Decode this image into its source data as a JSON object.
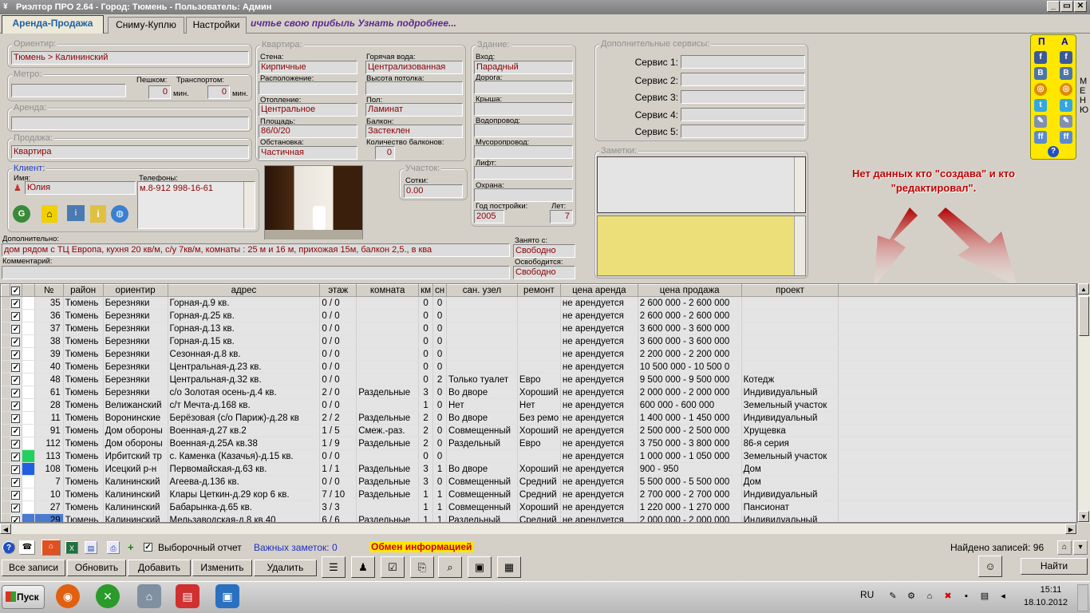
{
  "window": {
    "title": "Риэлтор ПРО 2.64 - Город: Тюмень - Пользователь: Админ",
    "minimize": "_",
    "restore": "▭",
    "close": "✕"
  },
  "tabs": [
    {
      "label": "Аренда-Продажа"
    },
    {
      "label": "Сниму-Куплю"
    },
    {
      "label": "Настройки"
    }
  ],
  "ticker": "ичтье свою прибыль Узнать подробнее...",
  "orientir": {
    "title": "Ориентир:",
    "value": "Тюмень > Калининский"
  },
  "metro": {
    "title": "Метро:",
    "walk_label": "Пешком:",
    "walk_value": "0",
    "transport_label": "Транспортом:",
    "transport_value": "0",
    "unit": "мин."
  },
  "arenda": {
    "title": "Аренда:",
    "value": ""
  },
  "prodazha": {
    "title": "Продажа:",
    "value": "Квартира"
  },
  "client": {
    "title": "Клиент:",
    "name_label": "Имя:",
    "name_value": "Юлия",
    "phones_label": "Телефоны:",
    "phones_value": "м.8-912 998-16-61"
  },
  "apartment": {
    "title": "Квартира:",
    "walls_label": "Стена:",
    "walls_value": "Кирпичные",
    "hotwater_label": "Горячая вода:",
    "hotwater_value": "Централизованная",
    "location_label": "Расположение:",
    "location_value": "",
    "ceiling_label": "Высота потолка:",
    "ceiling_value": "",
    "heating_label": "Отопление:",
    "heating_value": "Центральное",
    "floor_label": "Пол:",
    "floor_value": "Ламинат",
    "area_label": "Площадь:",
    "area_value": "86/0/20",
    "balcony_label": "Балкон:",
    "balcony_value": "Застеклен",
    "furniture_label": "Обстановка:",
    "furniture_value": "Частичная",
    "balcony_count_label": "Количество балконов:",
    "balcony_count_value": "0"
  },
  "plot": {
    "title": "Участок:",
    "sotki_label": "Сотки:",
    "sotki_value": "0.00"
  },
  "building": {
    "title": "Здание:",
    "entrance_label": "Вход:",
    "entrance_value": "Парадный",
    "road_label": "Дорога:",
    "road_value": "",
    "roof_label": "Крыша:",
    "roof_value": "",
    "water_label": "Водопровод:",
    "water_value": "",
    "trash_label": "Мусоропровод:",
    "trash_value": "",
    "lift_label": "Лифт:",
    "lift_value": "",
    "security_label": "Охрана:",
    "security_value": "",
    "year_label": "Год постройки:",
    "year_value": "2005",
    "age_label": "Лет:",
    "age_value": "7"
  },
  "services": {
    "title": "Дополнительные сервисы:",
    "items": [
      {
        "label": "Сервис 1:"
      },
      {
        "label": "Сервис 2:"
      },
      {
        "label": "Сервис 3:"
      },
      {
        "label": "Сервис 4:"
      },
      {
        "label": "Сервис 5:"
      }
    ]
  },
  "notes": {
    "title": "Заметки:"
  },
  "social": {
    "col1": "П",
    "col2": "А",
    "help": "?"
  },
  "menu_vertical": "МЕНЮ",
  "annotation": "Нет данных кто \"создава\" и кто \"редактировал\".",
  "additional": {
    "label": "Дополнительно:",
    "value": "дом рядом с ТЦ Европа, кухня 20 кв/м, с/у 7кв/м, комнаты : 25 м и 16 м, прихожая 15м, балкон 2,5., в ква"
  },
  "comment": {
    "label": "Комментарий:",
    "value": ""
  },
  "occupied": {
    "label": "Занято с:",
    "value": "Свободно"
  },
  "freed": {
    "label": "Освободится:",
    "value": "Свободно"
  },
  "table": {
    "headers": [
      "№",
      "район",
      "ориентир",
      "адрес",
      "этаж",
      "комната",
      "км",
      "сн",
      "сан. узел",
      "ремонт",
      "цена аренда",
      "цена продажа",
      "проект"
    ],
    "rows": [
      [
        "35",
        "Тюмень",
        "Березняки",
        "Горная-д.9 кв.",
        "0 / 0",
        "",
        "0",
        "0",
        "",
        "",
        "не арендуется",
        "2 600 000 - 2 600 000",
        ""
      ],
      [
        "36",
        "Тюмень",
        "Березняки",
        "Горная-д.25 кв.",
        "0 / 0",
        "",
        "0",
        "0",
        "",
        "",
        "не арендуется",
        "2 600 000 - 2 600 000",
        ""
      ],
      [
        "37",
        "Тюмень",
        "Березняки",
        "Горная-д.13 кв.",
        "0 / 0",
        "",
        "0",
        "0",
        "",
        "",
        "не арендуется",
        "3 600 000 - 3 600 000",
        ""
      ],
      [
        "38",
        "Тюмень",
        "Березняки",
        "Горная-д.15 кв.",
        "0 / 0",
        "",
        "0",
        "0",
        "",
        "",
        "не арендуется",
        "3 600 000 - 3 600 000",
        ""
      ],
      [
        "39",
        "Тюмень",
        "Березняки",
        "Сезонная-д.8 кв.",
        "0 / 0",
        "",
        "0",
        "0",
        "",
        "",
        "не арендуется",
        "2 200 000 - 2 200 000",
        ""
      ],
      [
        "40",
        "Тюмень",
        "Березняки",
        "Центральная-д.23 кв.",
        "0 / 0",
        "",
        "0",
        "0",
        "",
        "",
        "не арендуется",
        "10 500 000 - 10 500 0",
        ""
      ],
      [
        "48",
        "Тюмень",
        "Березняки",
        "Центральная-д.32 кв.",
        "0 / 0",
        "",
        "0",
        "2",
        "Только туалет",
        "Евро",
        "не арендуется",
        "9 500 000 - 9 500 000",
        "Котедж"
      ],
      [
        "61",
        "Тюмень",
        "Березняки",
        "с/о Золотая осень-д.4 кв.",
        "2 / 0",
        "Раздельные",
        "3",
        "0",
        "Во дворе",
        "Хороший",
        "не арендуется",
        "2 000 000 - 2 000 000",
        "Индивидуальный"
      ],
      [
        "28",
        "Тюмень",
        "Велижанский",
        "с/т Мечта-д.168 кв.",
        "0 / 0",
        "",
        "1",
        "0",
        "Нет",
        "Нет",
        "не арендуется",
        "600 000 - 600 000",
        "Земельный участок"
      ],
      [
        "11",
        "Тюмень",
        "Воронинские",
        "Берёзовая (с/о Париж)-д.28 кв",
        "2 / 2",
        "Раздельные",
        "2",
        "0",
        "Во дворе",
        "Без ремо",
        "не арендуется",
        "1 400 000 - 1 450 000",
        "Индивидуальный"
      ],
      [
        "91",
        "Тюмень",
        "Дом обороны",
        "Военная-д.27 кв.2",
        "1 / 5",
        "Смеж.-раз.",
        "2",
        "0",
        "Совмещенный",
        "Хороший",
        "не арендуется",
        "2 500 000 - 2 500 000",
        "Хрущевка"
      ],
      [
        "112",
        "Тюмень",
        "Дом обороны",
        "Военная-д.25А кв.38",
        "1 / 9",
        "Раздельные",
        "2",
        "0",
        "Раздельный",
        "Евро",
        "не арендуется",
        "3 750 000 - 3 800 000",
        "86-я серия"
      ],
      [
        "113",
        "Тюмень",
        "Ирбитский тр",
        "с. Каменка (Казачья)-д.15 кв.",
        "0 / 0",
        "",
        "0",
        "0",
        "",
        "",
        "не арендуется",
        "1 000 000 - 1 050 000",
        "Земельный участок"
      ],
      [
        "108",
        "Тюмень",
        "Исецкий р-н",
        "Первомайская-д.63 кв.",
        "1 / 1",
        "Раздельные",
        "3",
        "1",
        "Во дворе",
        "Хороший",
        "не арендуется",
        "900 - 950",
        "Дом"
      ],
      [
        "7",
        "Тюмень",
        "Калининский",
        "Агеева-д.136 кв.",
        "0 / 0",
        "Раздельные",
        "3",
        "0",
        "Совмещенный",
        "Средний",
        "не арендуется",
        "5 500 000 - 5 500 000",
        "Дом"
      ],
      [
        "10",
        "Тюмень",
        "Калининский",
        "Клары Цеткин-д.29 кор 6 кв.",
        "7 / 10",
        "Раздельные",
        "1",
        "1",
        "Совмещенный",
        "Средний",
        "не арендуется",
        "2 700 000 - 2 700 000",
        "Индивидуальный"
      ],
      [
        "27",
        "Тюмень",
        "Калининский",
        "Бабарынка-д.65 кв.",
        "3 / 3",
        "",
        "1",
        "1",
        "Совмещенный",
        "Хороший",
        "не арендуется",
        "1 220 000 - 1 270 000",
        "Пансионат"
      ],
      [
        "29",
        "Тюмень",
        "Калининский",
        "Мельзаводская-д.8 кв.40",
        "6 / 6",
        "Раздельные",
        "1",
        "1",
        "Раздельный",
        "Средний",
        "не арендуется",
        "2 000 000 - 2 000 000",
        "Индивидуальный"
      ]
    ],
    "row_marks": {
      "12": "#20d060",
      "13": "#2060e0",
      "17": "#4a7ad0"
    }
  },
  "infobar": {
    "report_label": "Выборочный отчет",
    "important_label": "Важных заметок: 0",
    "exchange_label": "Обмен информацией",
    "found_label": "Найдено записей: 96"
  },
  "buttons": {
    "all": "Все записи",
    "refresh": "Обновить",
    "add": "Добавить",
    "edit": "Изменить",
    "delete": "Удалить",
    "find": "Найти"
  },
  "taskbar": {
    "start": "Пуск",
    "lang": "RU",
    "time": "15:11",
    "date": "18.10.2012"
  },
  "colors": {
    "accent_tab": "#2060a0",
    "field_text": "#8b0000",
    "annotation": "#c00000",
    "social_bg": "#ffe700",
    "exchange_bg": "#ffe700"
  }
}
